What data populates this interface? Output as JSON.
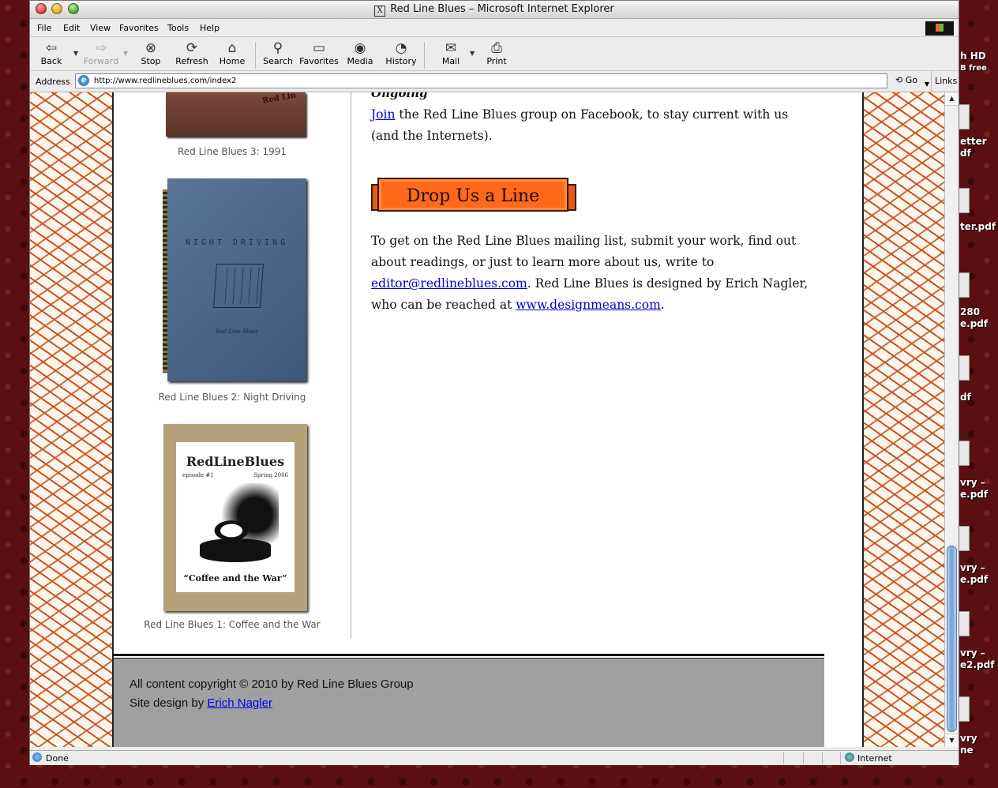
{
  "window": {
    "title": "Red Line Blues – Microsoft Internet Explorer",
    "title_icon": "X"
  },
  "menu": {
    "file": "File",
    "edit": "Edit",
    "view": "View",
    "favorites": "Favorites",
    "tools": "Tools",
    "help": "Help"
  },
  "toolbar": {
    "back": "Back",
    "forward": "Forward",
    "stop": "Stop",
    "refresh": "Refresh",
    "home": "Home",
    "search": "Search",
    "favorites": "Favorites",
    "media": "Media",
    "history": "History",
    "mail": "Mail",
    "print": "Print"
  },
  "address": {
    "label": "Address",
    "url": "http://www.redlineblues.com/index2",
    "go": "Go",
    "links": "Links"
  },
  "sidebar": {
    "covers": [
      {
        "caption": "Red Line Blues 3: 1991",
        "cover_text": "Red Lin"
      },
      {
        "caption": "Red Line Blues 2: Night Driving",
        "cover_text": "NIGHT DRIVING",
        "cover_small": "Red Line Blues"
      },
      {
        "caption": "Red Line Blues 1: Coffee and the War",
        "cover_brand": "RedLineBlues",
        "cover_episode": "episode #1",
        "cover_season": "Spring 2006",
        "cover_subtitle": "“Coffee and the War”"
      }
    ]
  },
  "main": {
    "ongoing_heading": "Ongoing",
    "join_link": "Join",
    "join_text": " the Red Line Blues group on Facebook, to stay current with us (and the Internets).",
    "banner_label": "Drop Us a Line",
    "mailing_text_1": "To get on the Red Line Blues mailing list, submit your work, find out about readings, or just to learn more about us, write to ",
    "email_link": "editor@redlineblues.com",
    "mailing_text_2": ". Red Line Blues is designed by Erich Nagler, who can be reached at ",
    "designer_link": "www.designmeans.com",
    "mailing_text_3": "."
  },
  "footer": {
    "copyright": "All content copyright © 2010 by Red Line Blues Group",
    "design_prefix": "Site design by ",
    "designer_name": "Erich Nagler"
  },
  "status": {
    "text": "Done",
    "zone": "Internet"
  },
  "desktop": {
    "labels": [
      "h HD",
      "B free",
      "etter",
      "df",
      "ter.pdf",
      "280",
      "e.pdf",
      "df",
      "vry –",
      "e.pdf",
      "vry –",
      "e.pdf",
      "vry –",
      "e2.pdf",
      "vry",
      "ne"
    ]
  }
}
